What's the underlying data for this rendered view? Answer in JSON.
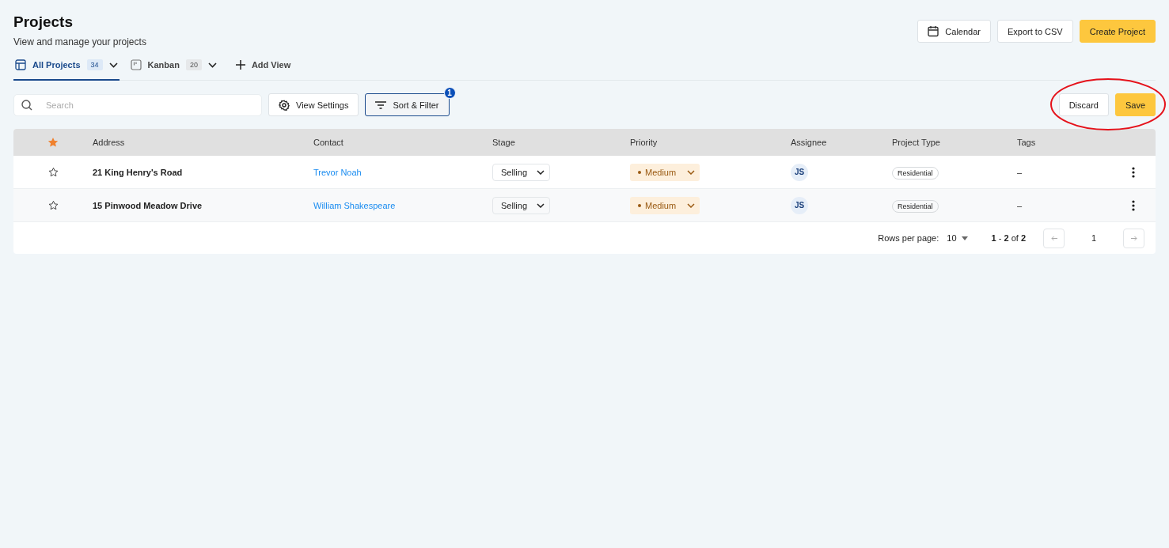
{
  "header": {
    "title": "Projects",
    "subtitle": "View and manage your projects"
  },
  "actions": [
    {
      "label": "Calendar",
      "kind": "calendar"
    },
    {
      "label": "Export to CSV",
      "kind": "plain"
    },
    {
      "label": "Create Project",
      "kind": "primary"
    }
  ],
  "tabs": [
    {
      "label": "All Projects",
      "count": "34",
      "kind": "table",
      "selected": true
    },
    {
      "label": "Kanban",
      "count": "20",
      "kind": "kanban",
      "selected": false
    },
    {
      "label": "Add View",
      "kind": "add",
      "selected": false
    }
  ],
  "search": {
    "placeholder": "Search"
  },
  "toolbar": [
    {
      "label": "View Settings",
      "kind": "gear",
      "active": false
    },
    {
      "label": "Sort & Filter",
      "kind": "filter",
      "active": true,
      "badge": "1"
    }
  ],
  "edit_actions": [
    {
      "label": "Discard",
      "kind": "plain"
    },
    {
      "label": "Save",
      "kind": "primary"
    }
  ],
  "table": {
    "columns": [
      "Address",
      "Contact",
      "Stage",
      "Priority",
      "Assignee",
      "Project Type",
      "Tags"
    ],
    "rows": [
      {
        "starred": false,
        "address": "21 King Henry's Road",
        "contact": "Trevor Noah",
        "stage": "Selling",
        "priority": "Medium",
        "assignee": "JS",
        "project_type": "Residential",
        "tags": "–"
      },
      {
        "starred": false,
        "address": "15 Pinwood Meadow Drive",
        "contact": "William Shakespeare",
        "stage": "Selling",
        "priority": "Medium",
        "assignee": "JS",
        "project_type": "Residential",
        "tags": "–"
      }
    ]
  },
  "pagination": {
    "rows_per_page_label": "Rows per page:",
    "rows_per_page": "10",
    "range": "**1** - **2** of **2**",
    "page": "1"
  }
}
